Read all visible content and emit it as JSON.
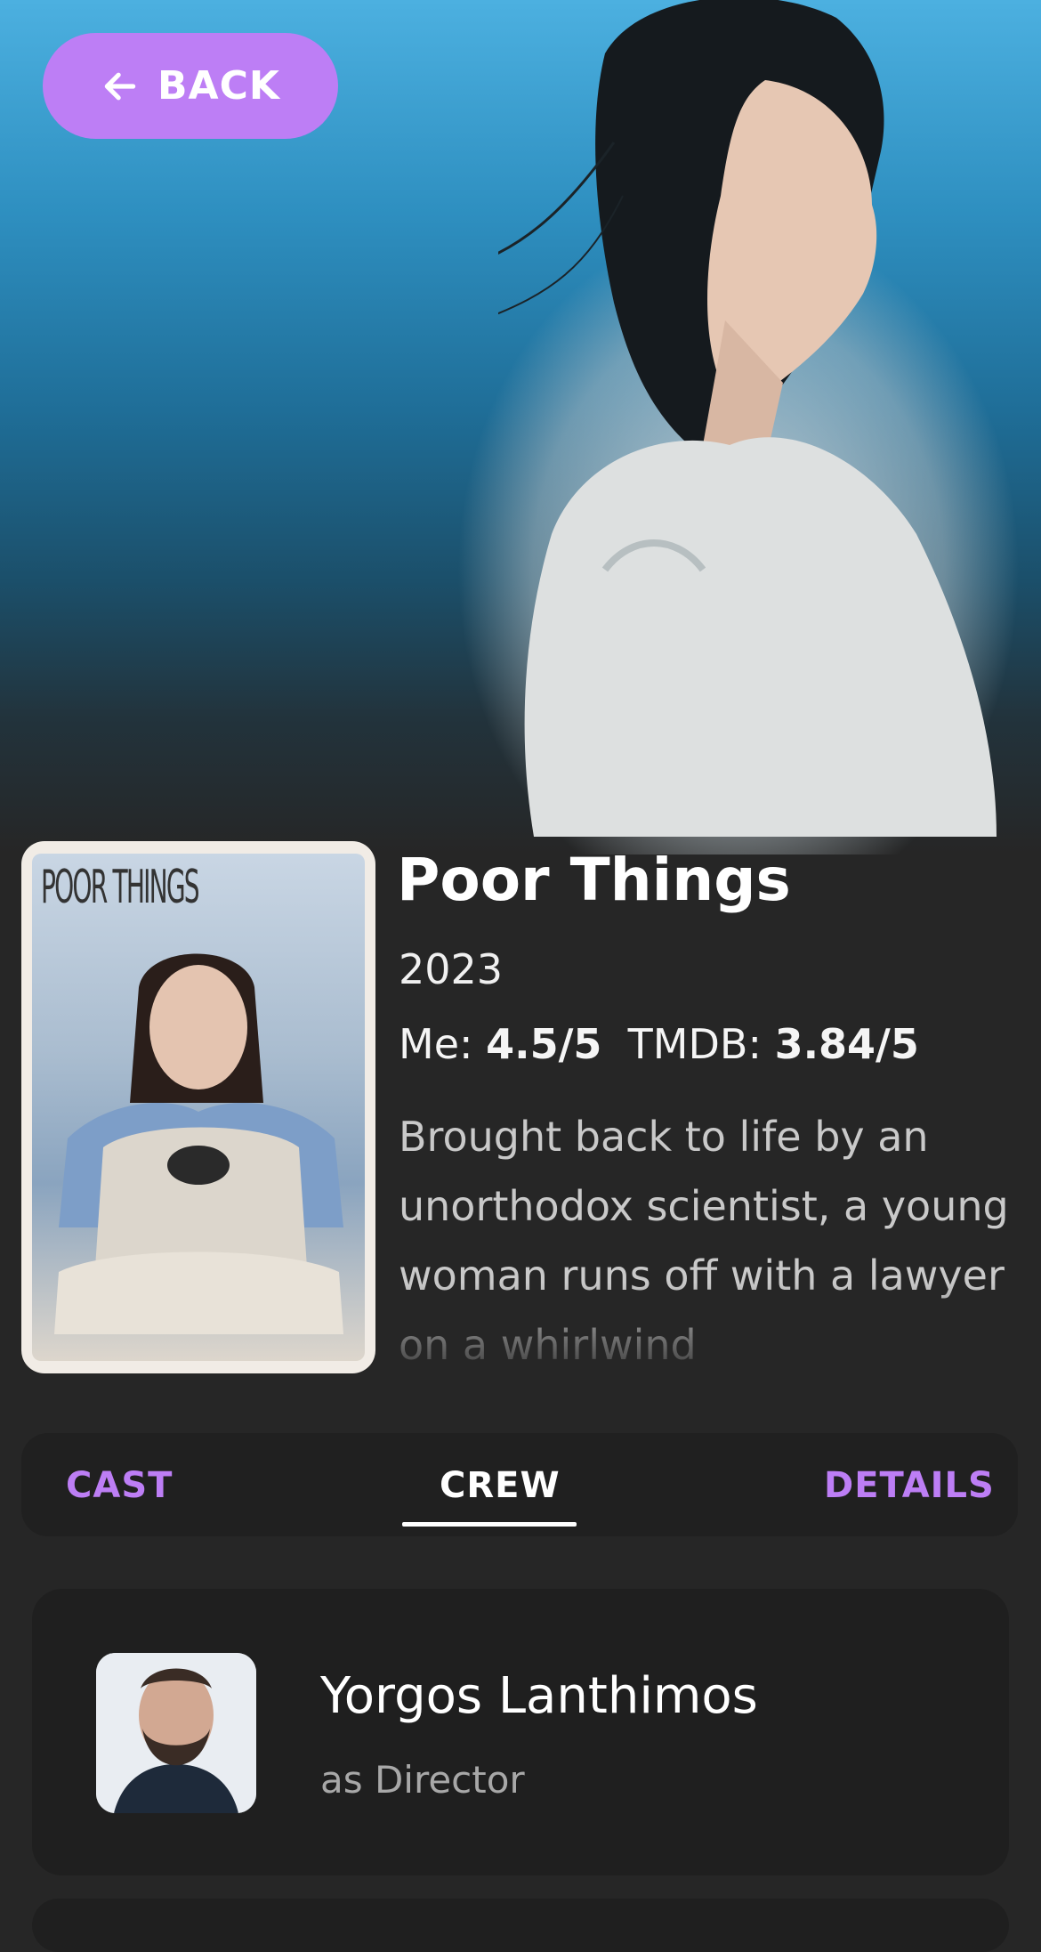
{
  "header": {
    "back_label": "BACK"
  },
  "movie": {
    "title": "Poor Things",
    "year": "2023",
    "poster_text": "POOR THINGS",
    "ratings": {
      "me_label": "Me:",
      "me_value": "4.5/5",
      "tmdb_label": "TMDB:",
      "tmdb_value": "3.84/5"
    },
    "overview": "Brought back to life by an unorthodox scientist, a young woman runs off with a lawyer on a whirlwind"
  },
  "tabs": [
    {
      "label": "CAST",
      "active": false
    },
    {
      "label": "CREW",
      "active": true
    },
    {
      "label": "DETAILS",
      "active": false
    }
  ],
  "crew": [
    {
      "name": "Yorgos Lanthimos",
      "role": "as Director"
    }
  ],
  "colors": {
    "accent": "#bd7ef5",
    "background": "#262626",
    "card": "#1f1f1f"
  }
}
